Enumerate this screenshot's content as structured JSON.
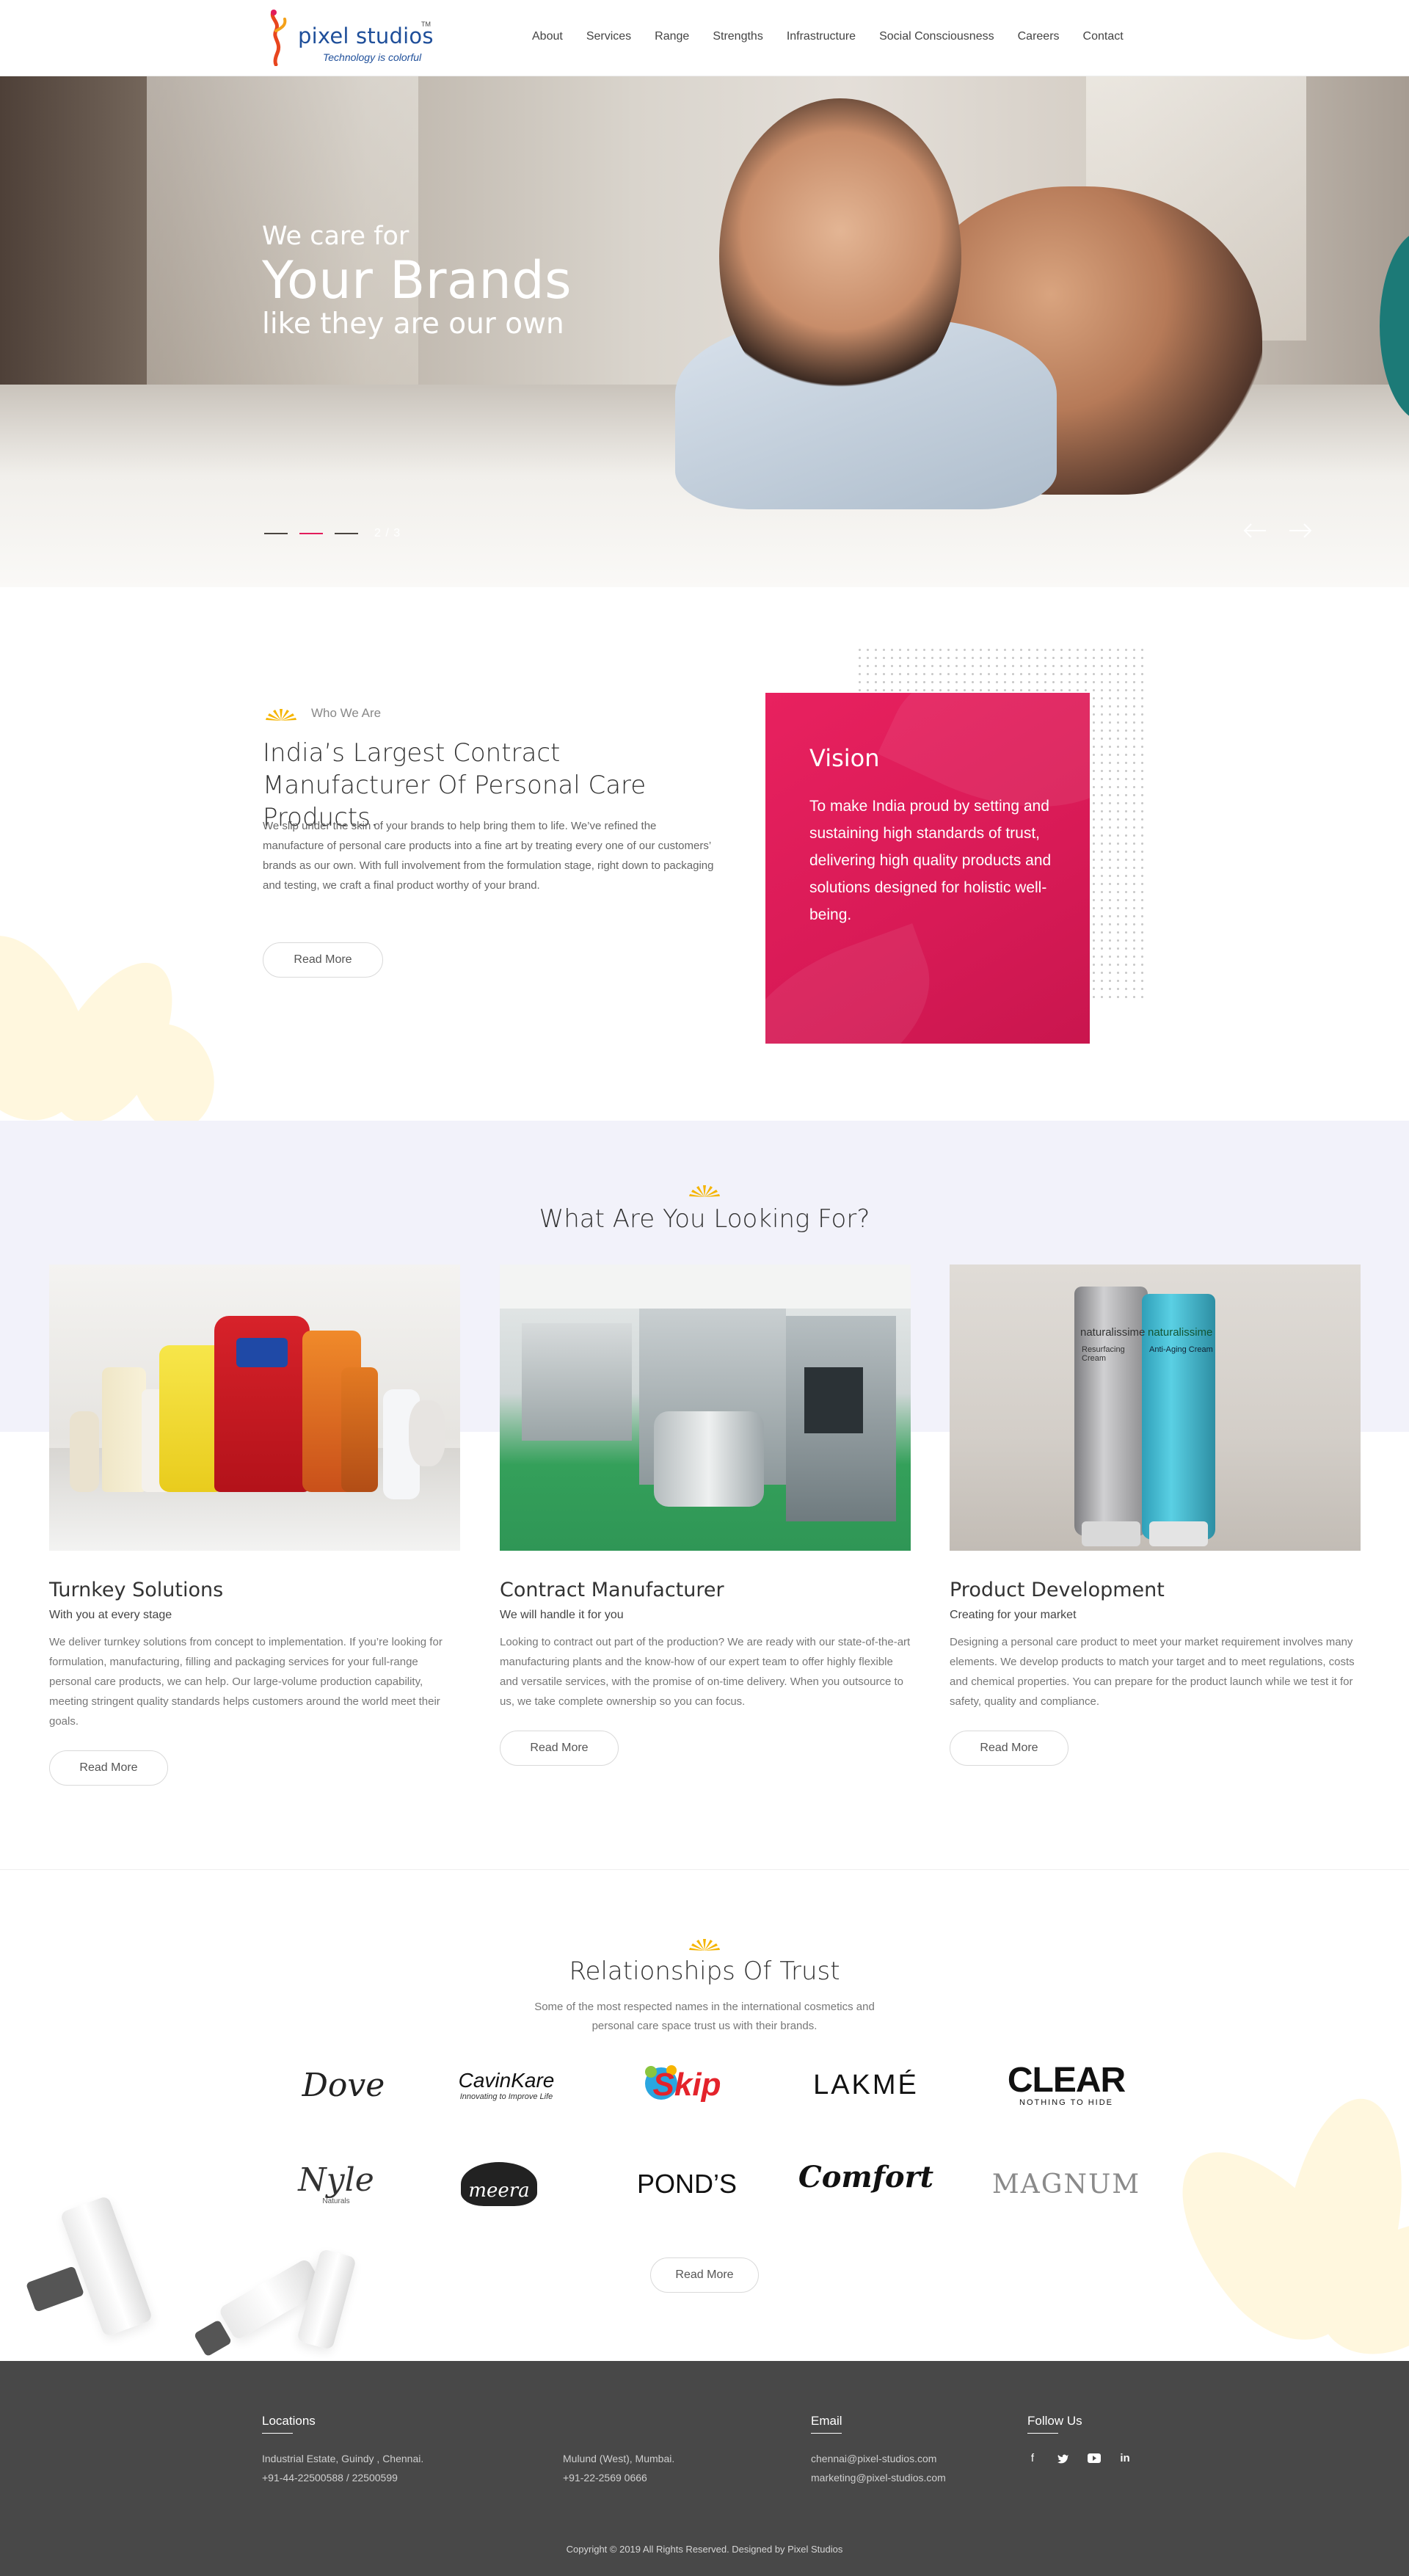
{
  "header": {
    "logo_name": "pixel studios",
    "logo_tm": "TM",
    "logo_tagline": "Technology is colorful",
    "nav": [
      "About",
      "Services",
      "Range",
      "Strengths",
      "Infrastructure",
      "Social Consciousness",
      "Careers",
      "Contact"
    ]
  },
  "hero": {
    "line1": "We care for",
    "line2": "Your Brands",
    "line3": "like they are our own",
    "slide_counter": "2 / 3",
    "active_slide": 2,
    "total_slides": 3,
    "prev_icon": "arrow-left-icon",
    "next_icon": "arrow-right-icon"
  },
  "who": {
    "kicker": "Who We Are",
    "title": "India’s Largest Contract Manufacturer Of Personal Care Products.",
    "body": "We slip under the skin of your brands to help bring them to life. We’ve refined the manufacture of personal care products into a fine art by treating every one of our customers’ brands as our own. With full involvement from the formulation stage, right down to packaging and testing, we craft a final product worthy of your brand.",
    "button": "Read More",
    "vision_title": "Vision",
    "vision_text": "To make India proud by setting and sustaining high standards of trust, delivering high quality products and solutions designed for holistic well- being."
  },
  "looking": {
    "title": "What Are You Looking For?",
    "cards": [
      {
        "title": "Turnkey Solutions",
        "subtitle": "With you at every stage",
        "desc": "We deliver turnkey solutions from concept to implementation. If you’re looking for formulation, manufacturing, filling and packaging services for your full-range personal care products, we can help. Our large-volume production capability, meeting stringent quality standards helps customers around the world meet their goals.",
        "button": "Read More"
      },
      {
        "title": "Contract Manufacturer",
        "subtitle": "We will handle it for you",
        "desc": "Looking to contract out part of the production? We are ready with our state-of-the-art manufacturing plants and the know-how of our expert team to offer highly flexible and versatile services, with the promise of on-time delivery. When you outsource to us, we take complete ownership so you can focus.",
        "button": "Read More"
      },
      {
        "title": "Product Development",
        "subtitle": "Creating for your market",
        "desc": "Designing a personal care product to meet your market requirement involves many elements. We develop products to match your target and to meet regulations, costs and chemical properties. You can prepare for the product launch while we test it for safety, quality and compliance.",
        "button": "Read More"
      }
    ],
    "product_labels": {
      "tube_brand": "naturalissime",
      "tube_a": "Resurfacing Cream",
      "tube_b": "Anti-Aging Cream"
    }
  },
  "trust": {
    "title": "Relationships Of Trust",
    "subtitle_line1": "Some of the most respected names in the international cosmetics and",
    "subtitle_line2": "personal care space trust us with their brands.",
    "brands": [
      {
        "name": "Dove"
      },
      {
        "name": "CavinKare",
        "tagline": "Innovating to Improve Life"
      },
      {
        "name": "Skip"
      },
      {
        "name": "LAKMÉ"
      },
      {
        "name": "CLEAR",
        "tagline": "NOTHING TO HIDE"
      },
      {
        "name": "Nyle",
        "tagline": "Naturals"
      },
      {
        "name": "meera"
      },
      {
        "name": "POND’S"
      },
      {
        "name": "Comfort"
      },
      {
        "name": "MAGNUM"
      }
    ],
    "button": "Read More"
  },
  "footer": {
    "locations_head": "Locations",
    "loc1_line1": "Industrial Estate, Guindy , Chennai.",
    "loc1_line2": "+91-44-22500588 / 22500599",
    "loc2_line1": "Mulund (West), Mumbai.",
    "loc2_line2": "+91-22-2569 0666",
    "email_head": "Email",
    "email1": "chennai@pixel-studios.com",
    "email2": "marketing@pixel-studios.com",
    "follow_head": "Follow Us",
    "social": [
      "facebook-icon",
      "twitter-icon",
      "youtube-icon",
      "linkedin-icon"
    ],
    "copyright": "Copyright © 2019 All Rights Reserved. Designed by Pixel Studios"
  },
  "colors": {
    "accent": "#e21c5b",
    "brand_blue": "#1f4f9a",
    "sun_yellow": "#f5b400",
    "footer_bg": "#484848",
    "band_bg": "#f2f2fa"
  }
}
